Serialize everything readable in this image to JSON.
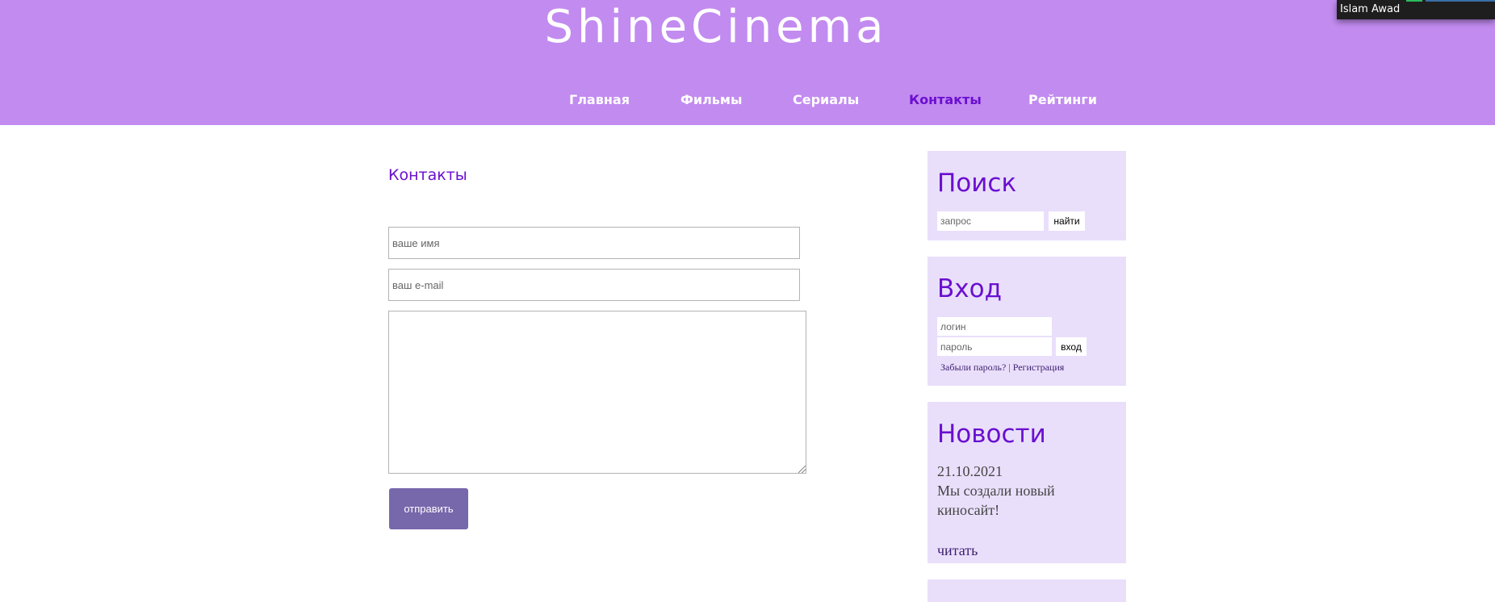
{
  "site": {
    "title": "ShineCinema"
  },
  "nav": {
    "items": [
      {
        "label": "Главная"
      },
      {
        "label": "Фильмы"
      },
      {
        "label": "Сериалы"
      },
      {
        "label": "Контакты",
        "active": true
      },
      {
        "label": "Рейтинги"
      }
    ]
  },
  "user": {
    "name": "Islam Awad"
  },
  "contact": {
    "heading": "Контакты",
    "name_placeholder": "ваше имя",
    "email_placeholder": "ваш e-mail",
    "message_value": "",
    "submit_label": "отправить"
  },
  "sidebar": {
    "search": {
      "title": "Поиск",
      "placeholder": "запрос",
      "button": "найти"
    },
    "login": {
      "title": "Вход",
      "login_placeholder": "логин",
      "password_placeholder": "пароль",
      "button": "вход",
      "forgot_link": "Забыли пароль?",
      "separator": "|",
      "register_link": "Регистрация"
    },
    "news": {
      "title": "Новости",
      "date": "21.10.2021",
      "text": "Мы создали новый киносайт!",
      "read_link": "читать"
    }
  },
  "colors": {
    "header_bg": "#c28bf0",
    "accent": "#6a0fcf",
    "widget_bg": "#e9dffb",
    "button_bg": "#7767ab"
  }
}
